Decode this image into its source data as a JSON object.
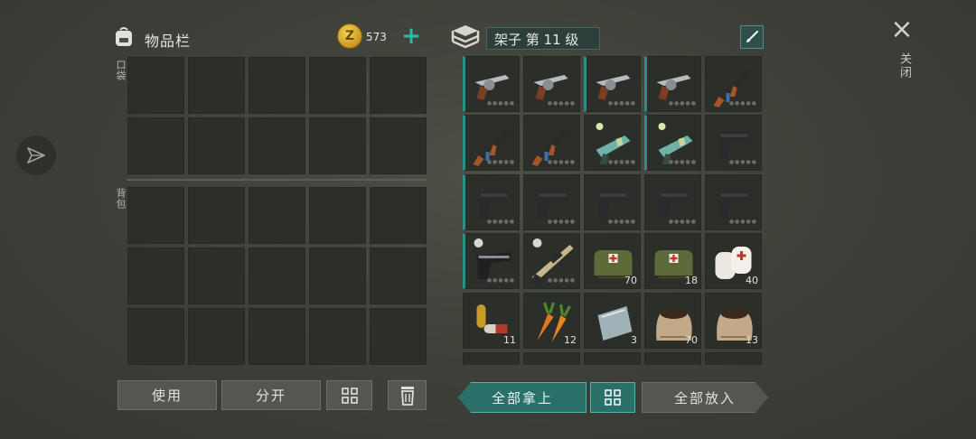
{
  "inventory": {
    "title": "物品栏",
    "coins": "573",
    "coin_symbol": "Z",
    "pocket_label": "口袋",
    "backpack_label": "背包"
  },
  "storage": {
    "title": "架子 第 11 级"
  },
  "close": {
    "label": "关闭"
  },
  "buttons": {
    "use": "使用",
    "split": "分开",
    "take_all": "全部拿上",
    "put_all": "全部放入"
  },
  "items": [
    {
      "kind": "revolver",
      "qty": "",
      "marked": true
    },
    {
      "kind": "revolver",
      "qty": "",
      "marked": false
    },
    {
      "kind": "revolver",
      "qty": "",
      "marked": true
    },
    {
      "kind": "revolver",
      "qty": "",
      "marked": true
    },
    {
      "kind": "rifle",
      "qty": "",
      "marked": false
    },
    {
      "kind": "rifle",
      "qty": "",
      "marked": true
    },
    {
      "kind": "rifle",
      "qty": "",
      "marked": false
    },
    {
      "kind": "blaster",
      "qty": "",
      "marked": false
    },
    {
      "kind": "blaster",
      "qty": "",
      "marked": true
    },
    {
      "kind": "pistol",
      "qty": "",
      "marked": false
    },
    {
      "kind": "pistol",
      "qty": "",
      "marked": true
    },
    {
      "kind": "pistol",
      "qty": "",
      "marked": false
    },
    {
      "kind": "pistol",
      "qty": "",
      "marked": false
    },
    {
      "kind": "pistol",
      "qty": "",
      "marked": false
    },
    {
      "kind": "pistol",
      "qty": "",
      "marked": false
    },
    {
      "kind": "deagle",
      "qty": "",
      "marked": true
    },
    {
      "kind": "sniper",
      "qty": "",
      "marked": false
    },
    {
      "kind": "medkit",
      "qty": "70",
      "marked": false
    },
    {
      "kind": "medkit",
      "qty": "18",
      "marked": false
    },
    {
      "kind": "bandage",
      "qty": "40",
      "marked": false
    },
    {
      "kind": "pills",
      "qty": "11",
      "marked": false
    },
    {
      "kind": "carrot",
      "qty": "12",
      "marked": false
    },
    {
      "kind": "plate",
      "qty": "3",
      "marked": false
    },
    {
      "kind": "sack",
      "qty": "70",
      "marked": false
    },
    {
      "kind": "sack",
      "qty": "13",
      "marked": false
    }
  ],
  "colors": {
    "accent": "#2b6f69",
    "accent_border": "#59b2a7",
    "slot_bg": "#2c2e2a",
    "plus": "#2fb8a6"
  }
}
